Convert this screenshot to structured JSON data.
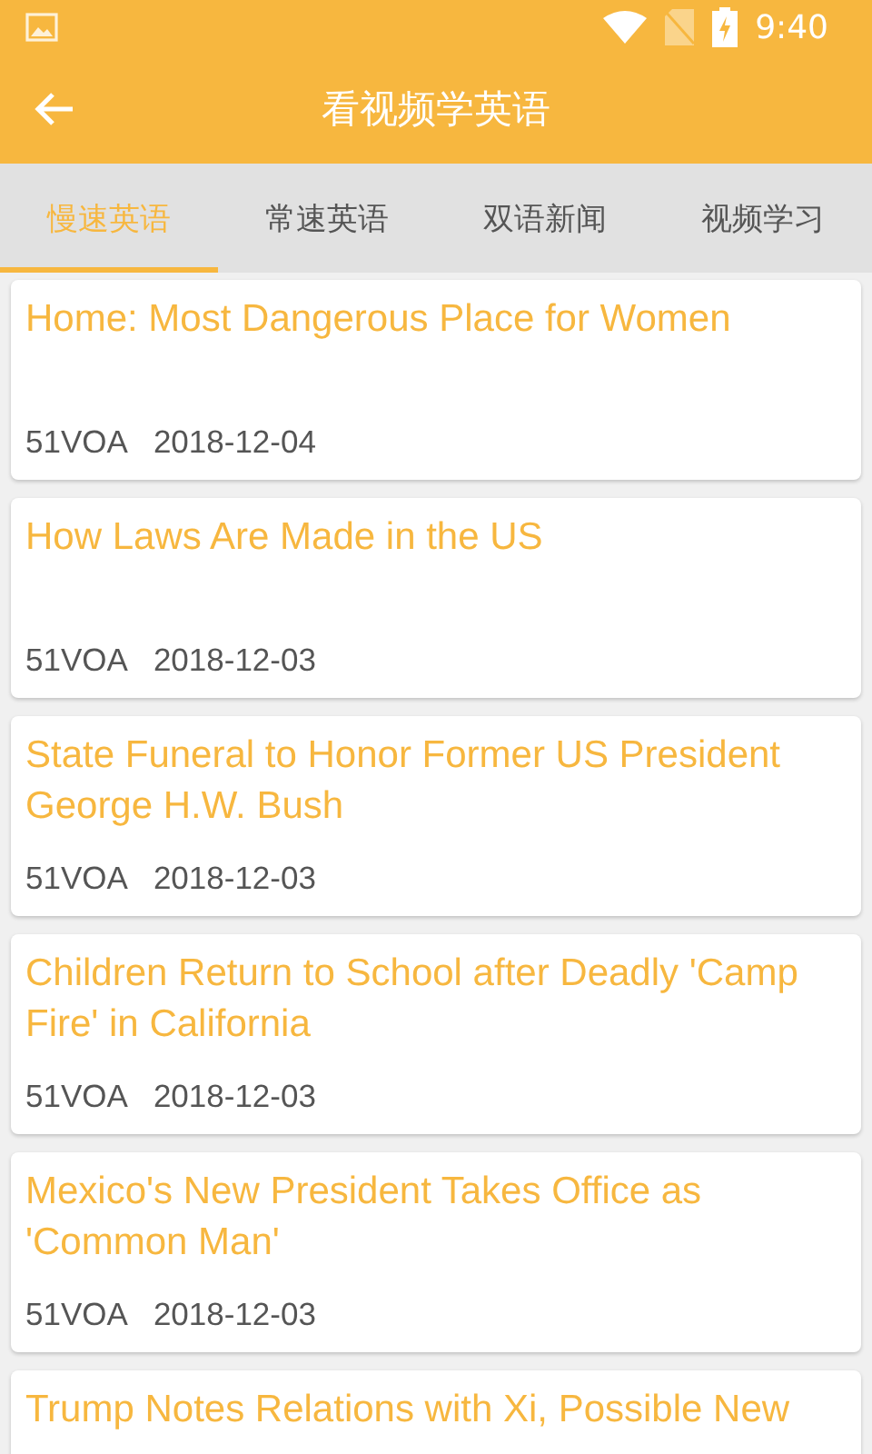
{
  "status_bar": {
    "time": "9:40"
  },
  "header": {
    "title": "看视频学英语"
  },
  "tabs": [
    {
      "label": "慢速英语",
      "selected": true
    },
    {
      "label": "常速英语",
      "selected": false
    },
    {
      "label": "双语新闻",
      "selected": false
    },
    {
      "label": "视频学习",
      "selected": false
    }
  ],
  "articles": [
    {
      "title": "Home: Most Dangerous Place for Women",
      "source": "51VOA",
      "date": "2018-12-04"
    },
    {
      "title": "How Laws Are Made in the US",
      "source": "51VOA",
      "date": "2018-12-03"
    },
    {
      "title": "State Funeral to Honor Former US President George H.W. Bush",
      "source": "51VOA",
      "date": "2018-12-03"
    },
    {
      "title": "Children Return to School after Deadly 'Camp Fire' in California",
      "source": "51VOA",
      "date": "2018-12-03"
    },
    {
      "title": "Mexico's New President Takes Office as 'Common Man'",
      "source": "51VOA",
      "date": "2018-12-03"
    },
    {
      "title": "Trump Notes Relations with Xi, Possible New"
    }
  ]
}
